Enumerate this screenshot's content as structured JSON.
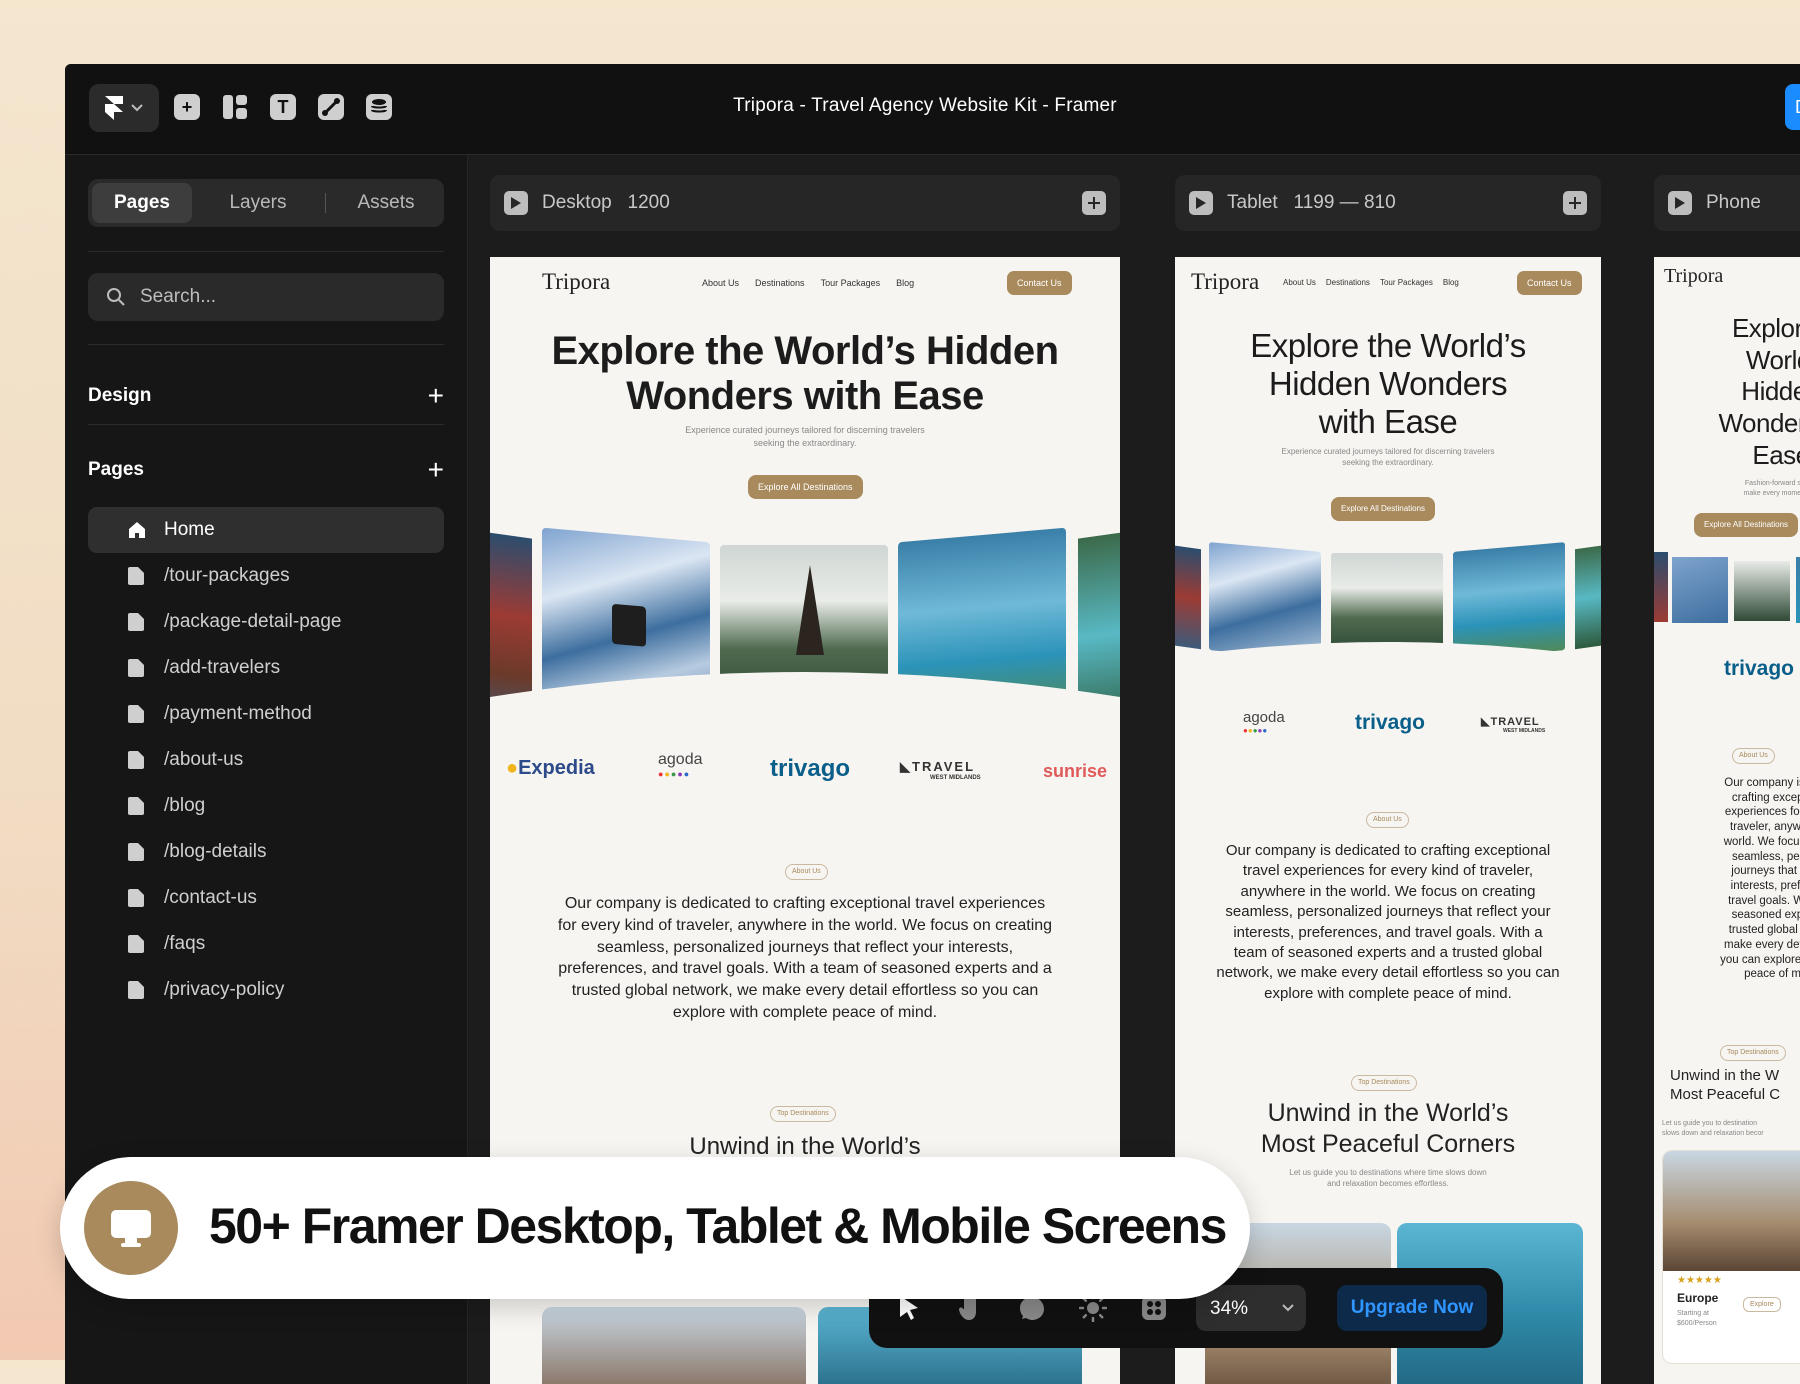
{
  "app": {
    "title": "Tripora - Travel Agency Website Kit - Framer",
    "blue_button": "D"
  },
  "sidebar": {
    "tabs": [
      "Pages",
      "Layers",
      "Assets"
    ],
    "search_placeholder": "Search...",
    "design_label": "Design",
    "pages_label": "Pages",
    "pages": [
      "Home",
      "/tour-packages",
      "/package-detail-page",
      "/add-travelers",
      "/payment-method",
      "/about-us",
      "/blog",
      "/blog-details",
      "/contact-us",
      "/faqs",
      "/privacy-policy"
    ]
  },
  "breakpoints": {
    "desktop": {
      "name": "Desktop",
      "width": "1200"
    },
    "tablet": {
      "name": "Tablet",
      "size": "1199 — 810"
    },
    "phone": {
      "name": "Phone"
    }
  },
  "site": {
    "brand": "Tripora",
    "nav_links": [
      "About Us",
      "Destinations",
      "Tour Packages",
      "Blog"
    ],
    "contact": "Contact Us",
    "hero_desktop": [
      "Explore the World’s Hidden",
      "Wonders with Ease"
    ],
    "hero_tablet": [
      "Explore the World’s",
      "Hidden Wonders",
      "with Ease"
    ],
    "hero_phone": [
      "Explore t",
      "World’",
      "Hidden",
      "Wonders w",
      "Ease"
    ],
    "hero_sub": [
      "Experience curated journeys tailored for discerning travelers",
      "seeking the extraordinary."
    ],
    "phone_sub": [
      "Fashion-forward styles cr",
      "make every moment mem"
    ],
    "cta": "Explore All Destinations",
    "partners": [
      "Expedia",
      "agoda",
      "trivago",
      "TRAVEL",
      "sunrise"
    ],
    "partner_sub": "WEST MIDLANDS",
    "about_pill": "About Us",
    "about_desktop": [
      "Our company is dedicated to crafting exceptional travel experiences",
      "for every kind of traveler, anywhere in the world. We focus on creating",
      "seamless, personalized journeys that reflect your interests,",
      "preferences, and travel goals. With a team of seasoned experts and a",
      "trusted global network, we make every detail effortless so you can",
      "explore with complete peace of mind."
    ],
    "about_tablet": [
      "Our company is dedicated to crafting exceptional",
      "travel experiences for every kind of traveler,",
      "anywhere in the world. We focus on creating",
      "seamless, personalized journeys that reflect your",
      "interests, preferences, and travel goals. With a",
      "team of seasoned experts and a trusted global",
      "network, we make every detail effortless so you can",
      "explore with complete peace of mind."
    ],
    "about_phone": [
      "Our company is dedi",
      "crafting exception",
      "experiences for ever",
      "traveler, anywhere",
      "world. We focus on c",
      "seamless, person",
      "journeys that refle",
      "interests, preferen",
      "travel goals. With a",
      "seasoned experts",
      "trusted global netw",
      "make every detail eff",
      "you can explore with c",
      "peace of min"
    ],
    "dest_pill": "Top Destinations",
    "dest_desktop": [
      "Unwind in the World’s"
    ],
    "dest_tablet": [
      "Unwind in the World’s",
      "Most Peaceful Corners"
    ],
    "dest_phone": [
      "Unwind in the W",
      "Most Peaceful C"
    ],
    "dest_sub": [
      "Let us guide you to destinations where time slows down",
      "and relaxation becomes effortless."
    ],
    "dest_sub_phone": [
      "Let us guide you to destination",
      "slows down and relaxation becor"
    ],
    "card_stars": "★★★★★",
    "card_region": "Europe",
    "card_price": [
      "Starting at",
      "$600/Person"
    ],
    "card_btn": "Explore"
  },
  "banner": {
    "text": "50+ Framer Desktop, Tablet & Mobile Screens"
  },
  "bottom_toolbar": {
    "zoom": "34%",
    "upgrade": "Upgrade Now"
  },
  "colors": {
    "accent": "#a88a5d",
    "framer_blue": "#1b8cff",
    "upgrade_text": "#2f95ff"
  }
}
